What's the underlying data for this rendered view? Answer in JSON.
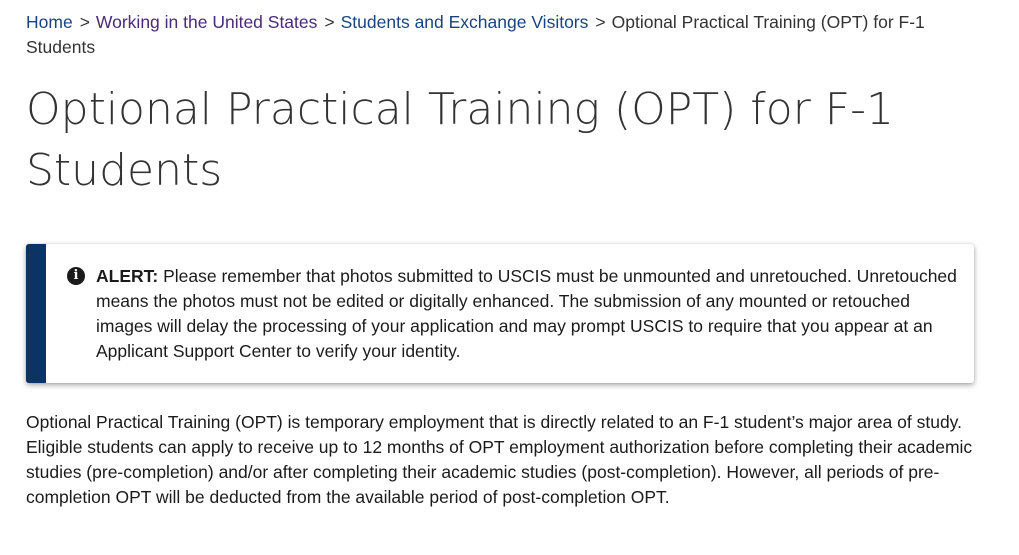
{
  "breadcrumb": {
    "items": [
      {
        "label": "Home"
      },
      {
        "label": "Working in the United States"
      },
      {
        "label": "Students and Exchange Visitors"
      }
    ],
    "separator": ">",
    "current": "Optional Practical Training (OPT) for F-1 Students"
  },
  "page": {
    "title": "Optional Practical Training (OPT) for F-1 Students"
  },
  "alert": {
    "icon": "info-icon",
    "icon_glyph": "i",
    "label": "ALERT:",
    "text": "Please remember that photos submitted to USCIS must be unmounted and unretouched. Unretouched means the photos must not be edited or digitally enhanced. The submission of any mounted or retouched images will delay the processing of your application and may prompt USCIS to require that you appear at an Applicant Support Center to verify your identity.",
    "border_color": "#0b3363"
  },
  "content": {
    "paragraph": "Optional Practical Training (OPT) is temporary employment that is directly related to an F-1 student’s major area of study. Eligible students can apply to receive up to 12 months of OPT employment authorization before completing their academic studies (pre-completion) and/or after completing their academic studies (post-completion). However, all periods of pre-completion OPT will be deducted from the available period of post-completion OPT."
  },
  "colors": {
    "link": "#1a4480",
    "visited_link": "#4b2a7a",
    "text": "#1b1b1b"
  }
}
